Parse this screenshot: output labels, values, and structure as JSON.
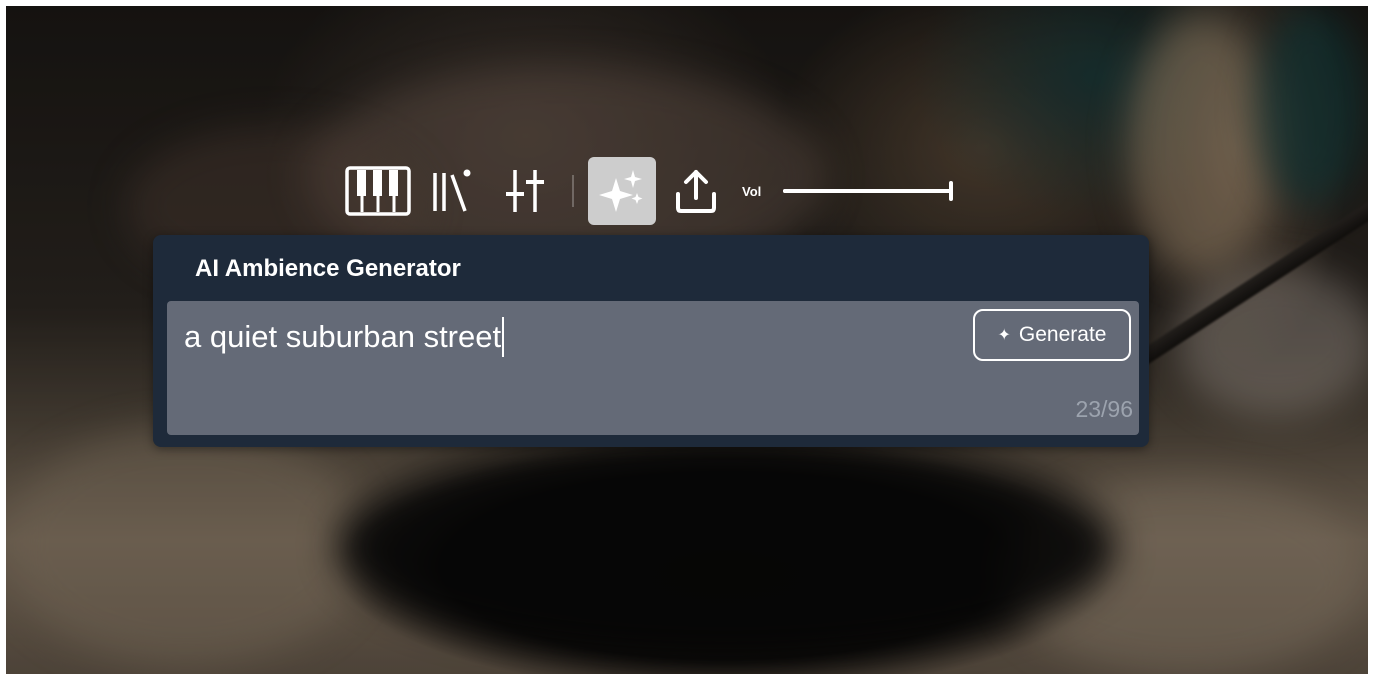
{
  "toolbar": {
    "tools": [
      {
        "icon": "piano-keys-icon",
        "active": false
      },
      {
        "icon": "library-icon",
        "active": false
      },
      {
        "icon": "sliders-icon",
        "active": false
      },
      {
        "icon": "sparkle-icon",
        "active": true
      },
      {
        "icon": "share-upload-icon",
        "active": false
      }
    ],
    "volume": {
      "label": "Vol",
      "level": 1.0
    }
  },
  "panel": {
    "title": "AI Ambience Generator",
    "prompt_value": "a quiet suburban street",
    "generate_label": "Generate",
    "counter": "23/96"
  },
  "colors": {
    "panel_bg": "#1e2a3a",
    "input_bg": "#646a77",
    "active_tool_bg": "#cdcdcd"
  }
}
